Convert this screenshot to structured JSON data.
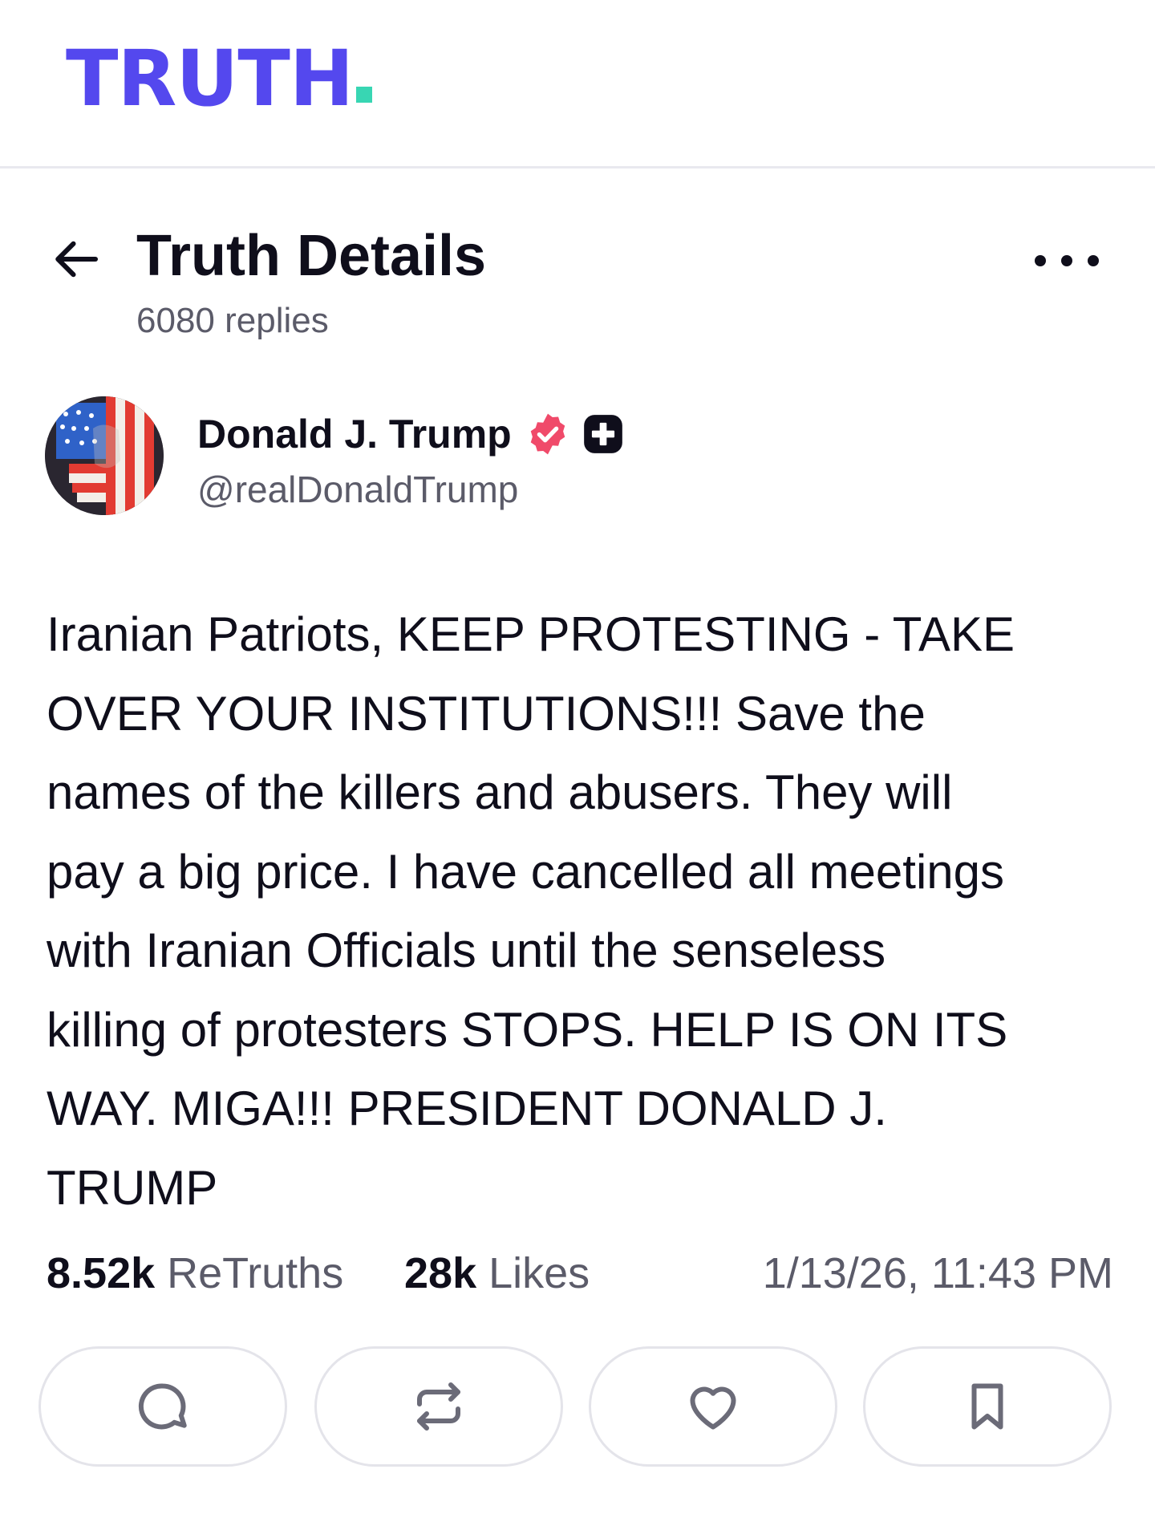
{
  "app": {
    "logo_text": "TRUTH",
    "brand_color": "#5448ee",
    "accent_color": "#38d6b3"
  },
  "header": {
    "title": "Truth Details",
    "reply_count": "6080 replies",
    "back_icon": "arrow-left-icon",
    "more_icon": "more-horizontal-icon"
  },
  "author": {
    "name": "Donald J. Trump",
    "handle": "@realDonaldTrump",
    "verified_icon": "verified-badge-icon",
    "verified_color": "#f04a6a",
    "extra_badge_icon": "plus-badge-icon"
  },
  "post": {
    "text": "Iranian Patriots, KEEP PROTESTING - TAKE\nOVER YOUR INSTITUTIONS!!! Save the\nnames of the killers and abusers. They will\npay a big price. I have cancelled all meetings\nwith Iranian Officials until the senseless\nkilling of protesters STOPS. HELP IS ON ITS\nWAY. MIGA!!! PRESIDENT DONALD J.\nTRUMP"
  },
  "stats": {
    "retruths_count": "8.52k",
    "retruths_label": "ReTruths",
    "likes_count": "28k",
    "likes_label": "Likes",
    "timestamp": "1/13/26, 11:43 PM"
  },
  "actions": [
    {
      "icon": "reply-icon"
    },
    {
      "icon": "retruth-icon"
    },
    {
      "icon": "like-heart-icon"
    },
    {
      "icon": "bookmark-icon"
    }
  ]
}
